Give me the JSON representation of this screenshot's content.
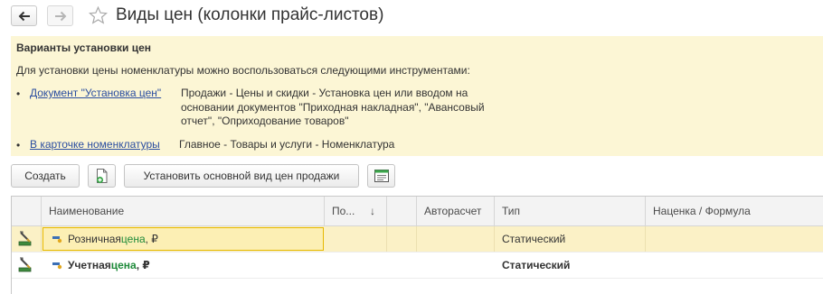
{
  "window": {
    "title": "Виды цен (колонки прайс-листов)"
  },
  "info_panel": {
    "heading": "Варианты установки цен",
    "intro": "Для установки цены номенклатуры можно воспользоваться следующими инструментами:",
    "items": [
      {
        "link": "Документ \"Установка цен\"",
        "desc_lines": [
          "Продажи - Цены и скидки - Установка цен или вводом на",
          "основании документов \"Приходная накладная\", \"Авансовый",
          "отчет\", \"Оприходование товаров\""
        ]
      },
      {
        "link": "В карточке номенклатуры",
        "desc_lines": [
          "Главное - Товары и услуги - Номенклатура"
        ]
      }
    ]
  },
  "toolbar": {
    "create_label": "Создать",
    "set_main_label": "Установить основной вид цен продажи"
  },
  "table": {
    "columns": [
      "Наименование",
      "По...",
      "Авторасчет",
      "Тип",
      "Наценка / Формула"
    ],
    "sort_indicator": "↓",
    "rows": [
      {
        "name_prefix": "Розничная ",
        "name_highlight": "цена",
        "name_suffix": ", ₽",
        "type": "Статический",
        "bold": false,
        "selected": true
      },
      {
        "name_prefix": "Учетная ",
        "name_highlight": "цена",
        "name_suffix": ", ₽",
        "type": "Статический",
        "bold": true,
        "selected": false
      }
    ]
  },
  "colors": {
    "info_bg": "#fcf6d5",
    "link": "#2a4da0",
    "highlight_text": "#1e8a3a",
    "selected_row": "#fbf1c6",
    "focus_border": "#e6b800"
  },
  "icons": {
    "back": "arrow-left-icon",
    "forward": "arrow-right-icon",
    "favorite": "star-icon",
    "copy": "copy-document-icon",
    "price_list": "price-list-icon",
    "row": "price-kind-icon",
    "item": "price-tag-icon"
  }
}
